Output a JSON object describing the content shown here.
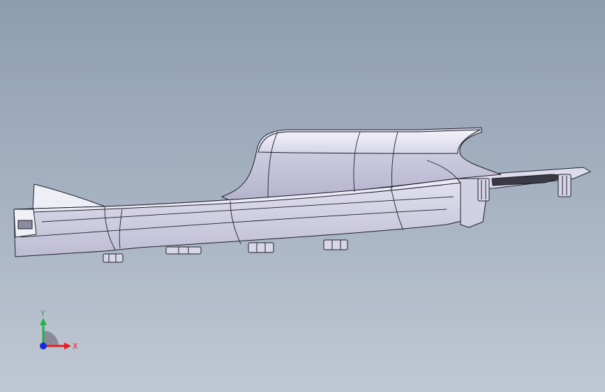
{
  "viewport": {
    "background_top": "#8d9db0",
    "background_bottom": "#c0c8d3"
  },
  "model": {
    "name": "part-3d-model",
    "body_color": "#e4e3f1",
    "shade_color": "#c4c3da",
    "edge_color": "#1f1f2a",
    "dark_color": "#3a3a44"
  },
  "triad": {
    "x_label": "X",
    "y_label": "Y",
    "x_color": "#e02020",
    "y_color": "#22b24c",
    "z_color": "#1a2ad8"
  }
}
